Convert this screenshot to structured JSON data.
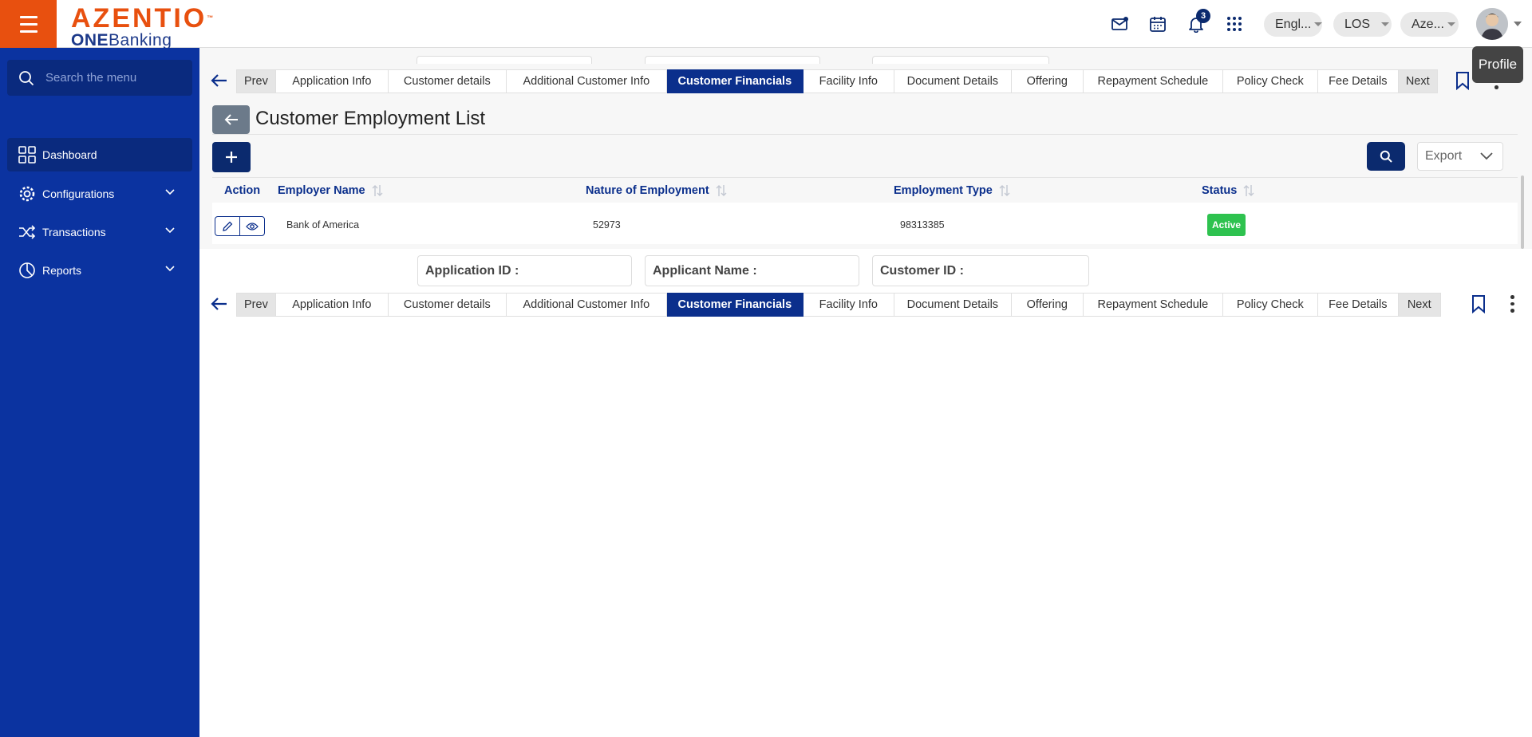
{
  "header": {
    "logo_main": "AZENTIO",
    "logo_tm": "™",
    "logo_sub_bold": "ONE",
    "logo_sub_light": "Banking",
    "notification_count": "3",
    "language": "Engl...",
    "module": "LOS",
    "entity": "Aze...",
    "profile_tooltip": "Profile"
  },
  "sidebar": {
    "search_placeholder": "Search the menu",
    "items": [
      {
        "label": "Dashboard",
        "icon": "grid-icon",
        "active": true
      },
      {
        "label": "Configurations",
        "icon": "gear-icon"
      },
      {
        "label": "Transactions",
        "icon": "shuffle-icon"
      },
      {
        "label": "Reports",
        "icon": "pie-chart-icon"
      }
    ]
  },
  "tabs": {
    "prev": "Prev",
    "next": "Next",
    "items": [
      "Application Info",
      "Customer details",
      "Additional Customer Info",
      "Customer Financials",
      "Facility Info",
      "Document Details",
      "Offering",
      "Repayment Schedule",
      "Policy Check",
      "Fee Details"
    ],
    "active_index": 3
  },
  "page": {
    "title": "Customer Employment List",
    "export_label": "Export"
  },
  "table": {
    "columns": [
      "Action",
      "Employer Name",
      "Nature of Employment",
      "Employment Type",
      "Status"
    ],
    "rows": [
      {
        "employer_name": "Bank of America",
        "nature_of_employment": "52973",
        "employment_type": "98313385",
        "status": "Active"
      }
    ]
  },
  "info_fields": {
    "application_id": "Application ID :",
    "applicant_name": "Applicant Name :",
    "customer_id": "Customer ID :"
  },
  "colors": {
    "brand_orange": "#e8500f",
    "sidebar_blue": "#0b33a0",
    "active_tab": "#0b2f8c",
    "status_active": "#2ec24f"
  }
}
